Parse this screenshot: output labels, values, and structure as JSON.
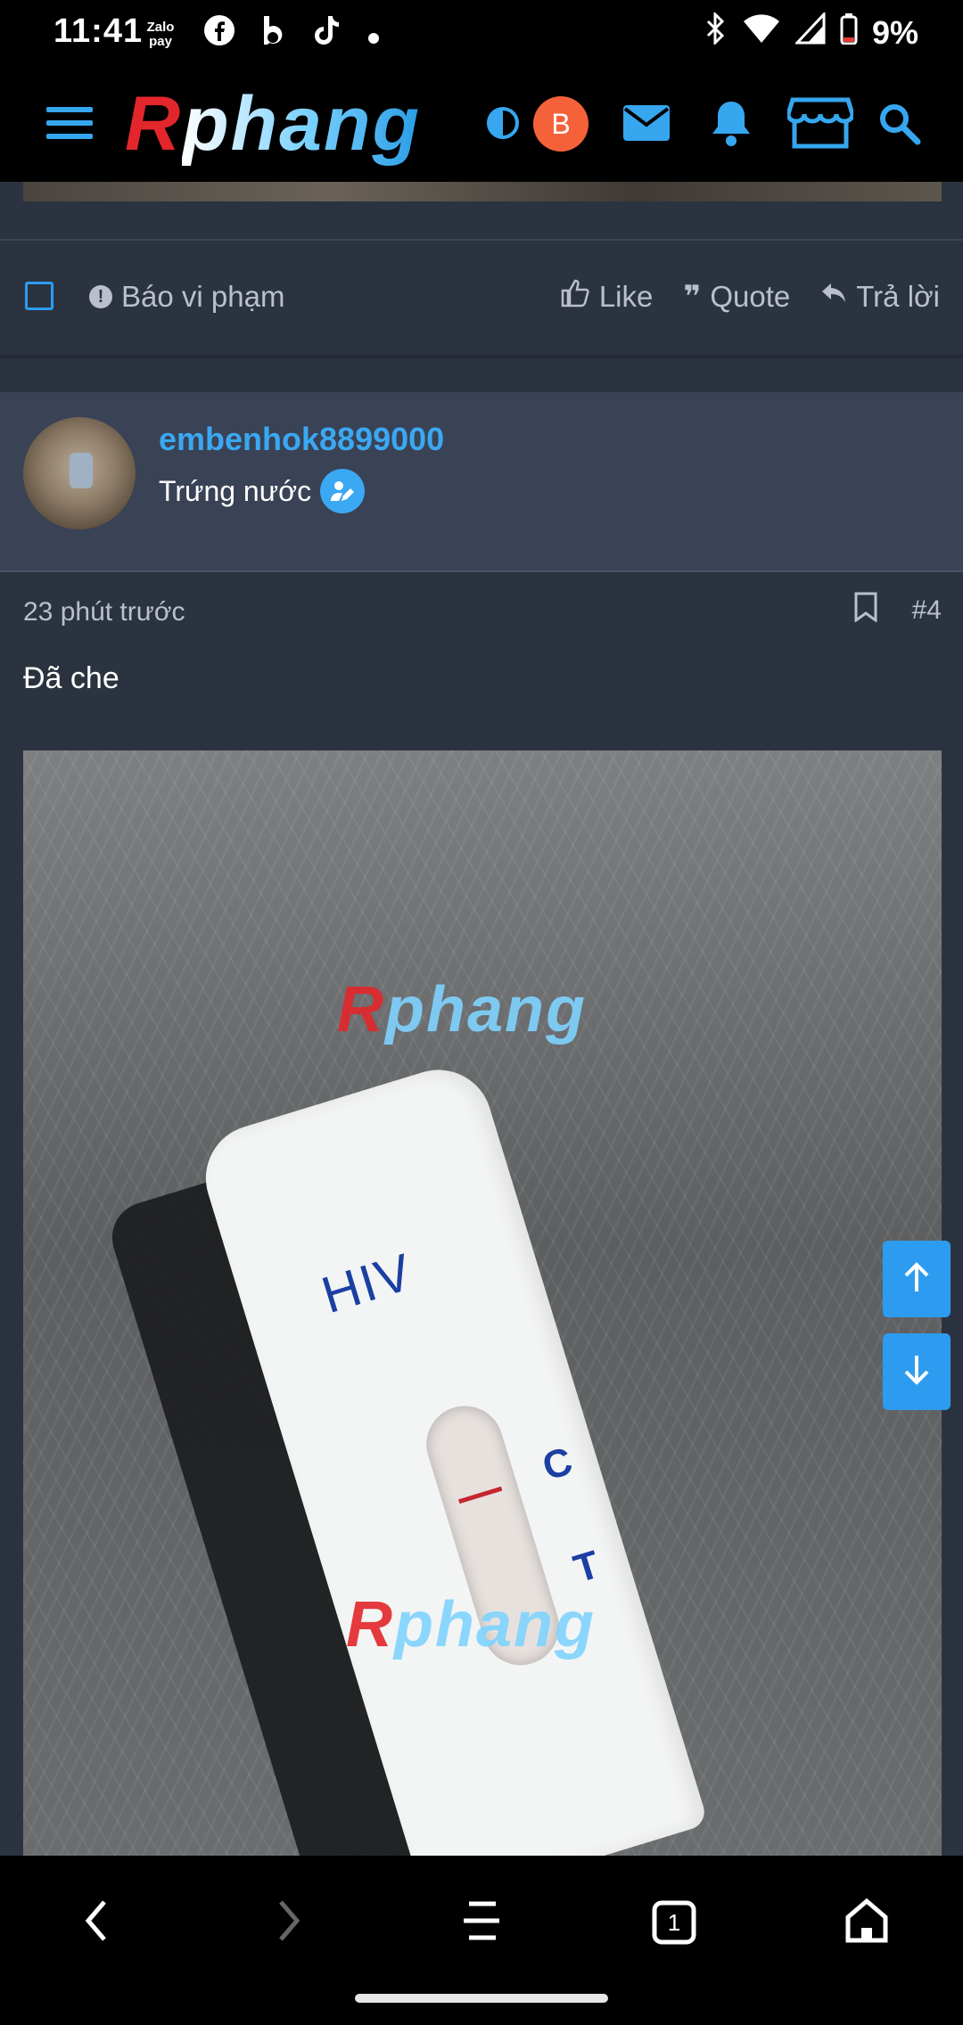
{
  "status_bar": {
    "time": "11:41",
    "app_icons": [
      "zalopay-icon",
      "facebook-icon",
      "b-icon",
      "tiktok-icon",
      "dot-icon"
    ],
    "zalopay_label": "Zalo pay",
    "battery": "9%"
  },
  "header": {
    "logo_r": "R",
    "logo_rest": "phang",
    "avatar_letter": "B"
  },
  "post_prev": {
    "report_label": "Báo vi phạm",
    "like_label": "Like",
    "quote_label": "Quote",
    "reply_label": "Trả lời"
  },
  "post": {
    "username": "embenhok8899000",
    "rank": "Trứng nước",
    "time": "23 phút trước",
    "number": "#4",
    "message": "Đã che",
    "watermark_r": "R",
    "watermark_rest": "phang",
    "test_brand": "HIV",
    "test_c": "C",
    "test_t": "T"
  },
  "bottom_nav": {
    "tabs_count": "1"
  },
  "colors": {
    "accent": "#2d9cf0",
    "background": "#2c3340",
    "card": "#3a4255",
    "logo_red": "#e3262b"
  }
}
